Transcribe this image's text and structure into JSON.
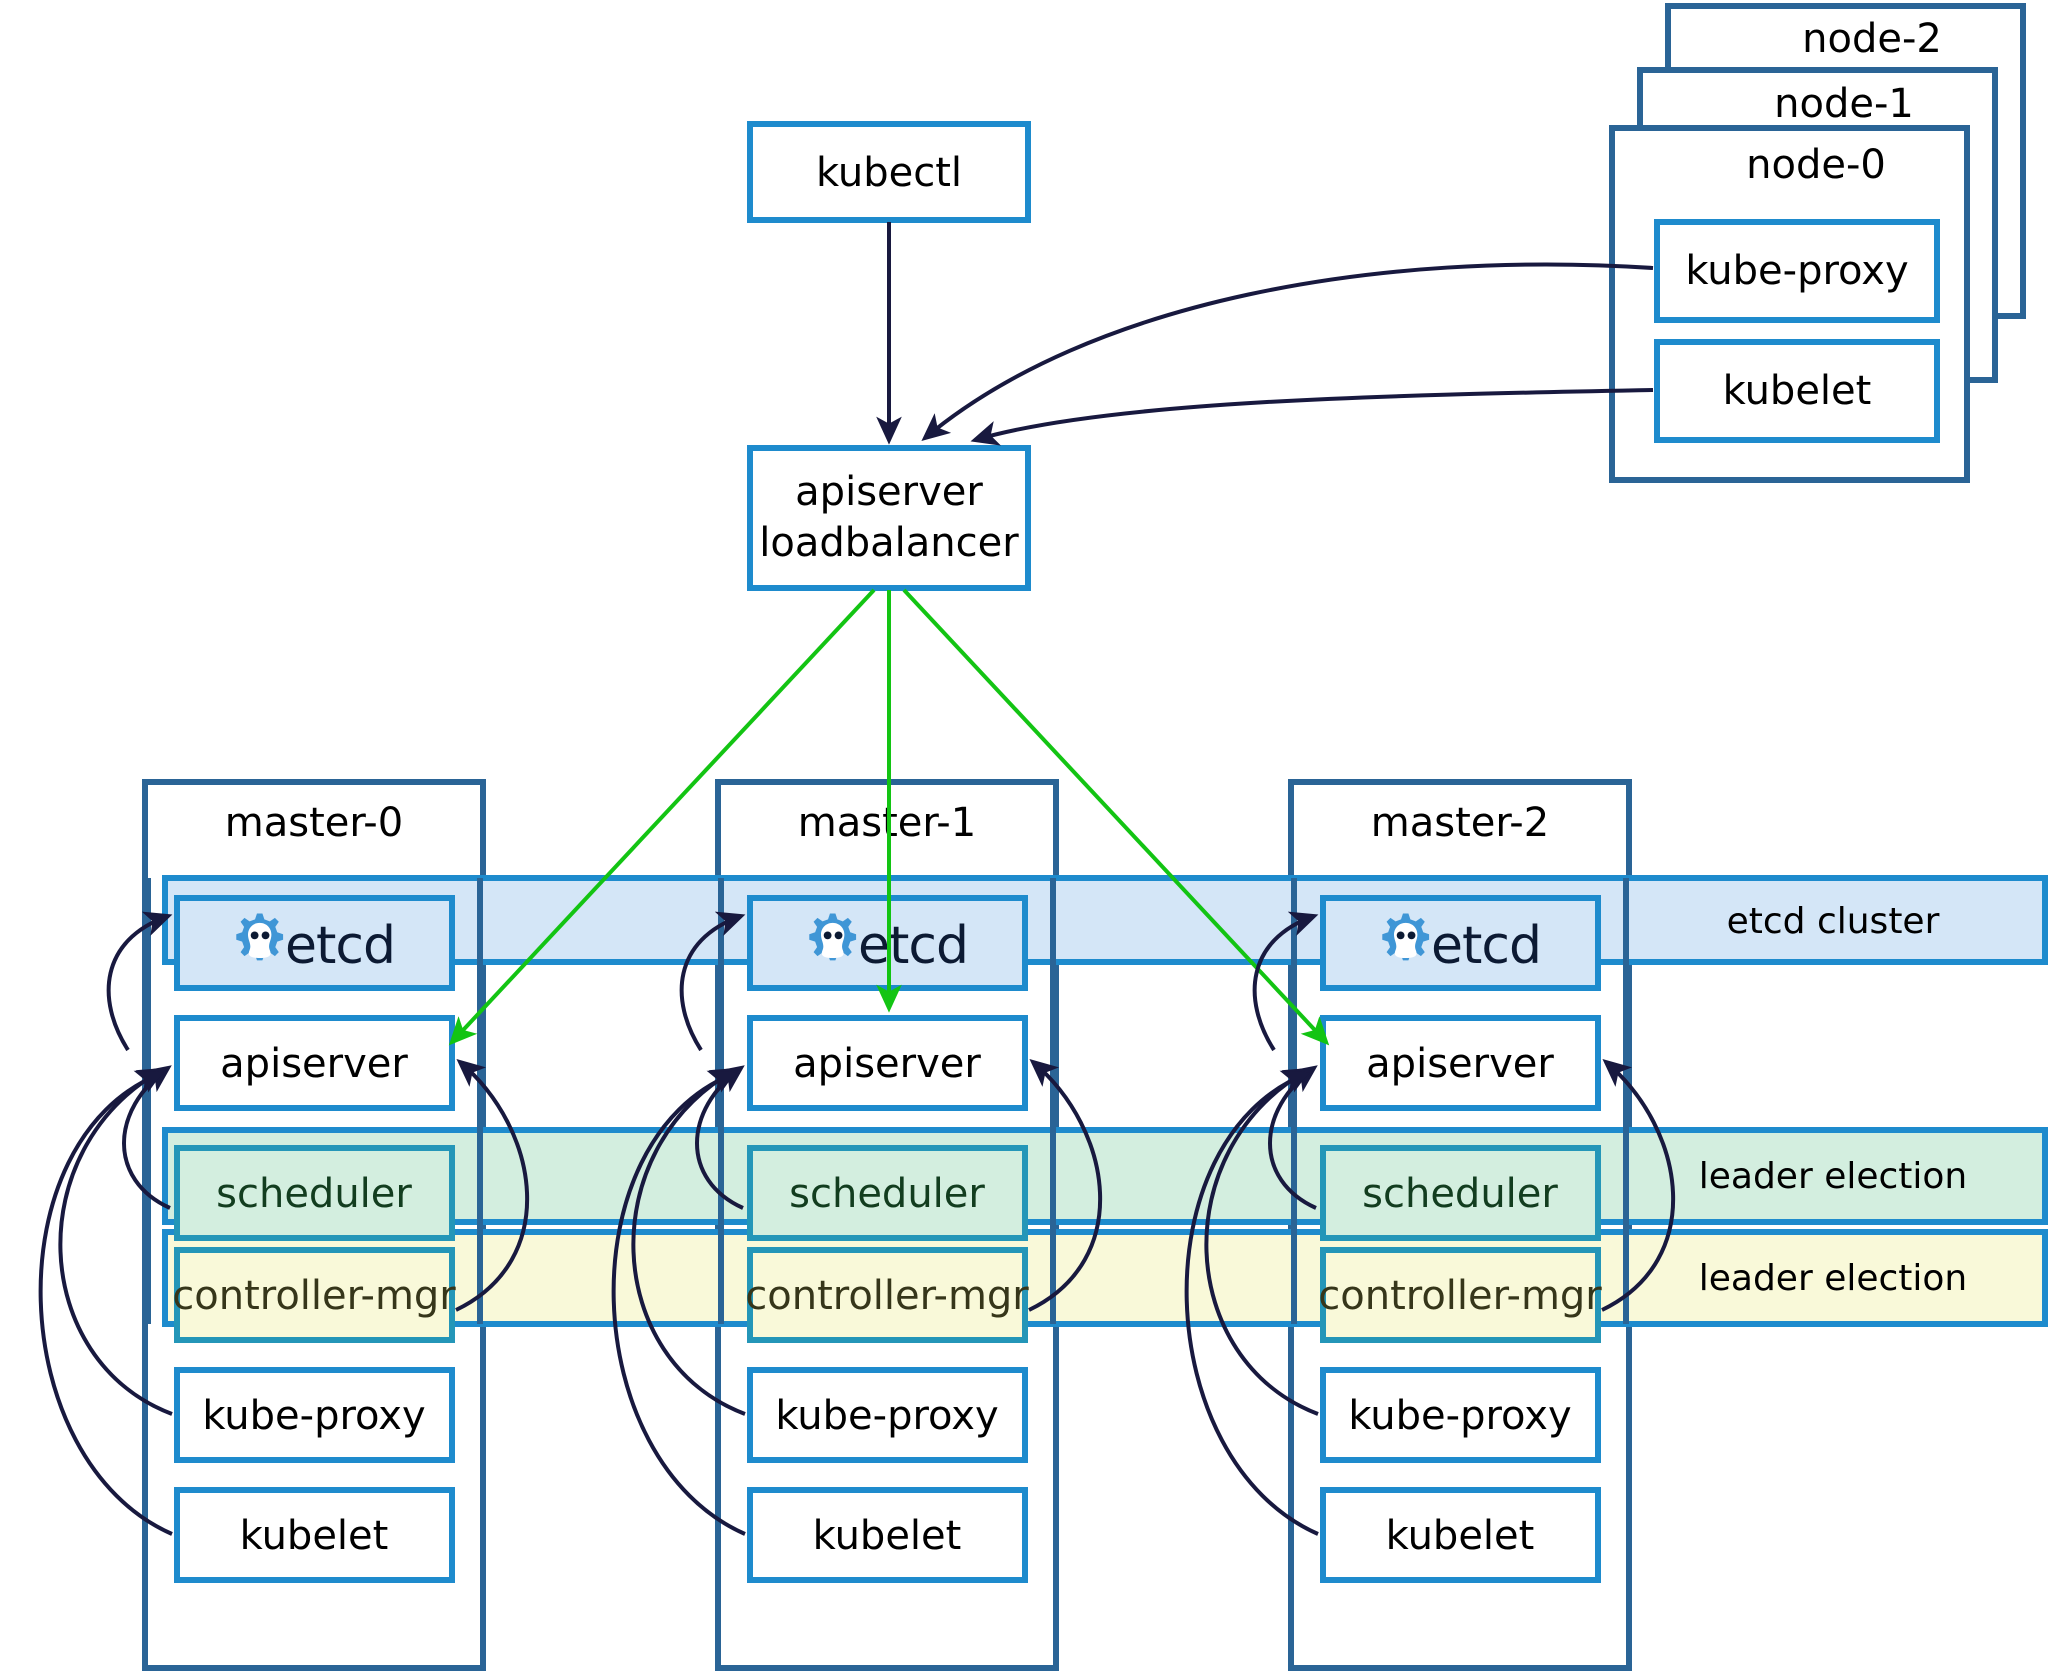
{
  "diagram": {
    "title": "Kubernetes high-availability cluster architecture",
    "colors": {
      "node_border": "#2a6496",
      "box_border": "#1e8bcd",
      "etcd_band": "#d4e6f7",
      "scheduler_band": "#d3eedf",
      "controller_band": "#f9f9d9",
      "arrow_dark": "#18193f",
      "arrow_green": "#13c413",
      "etcd_logo": "#3f96d6"
    }
  },
  "client": {
    "kubectl_label": "kubectl"
  },
  "loadbalancer": {
    "line1": "apiserver",
    "line2": "loadbalancer"
  },
  "nodes": {
    "stack_labels": [
      "node-2",
      "node-1",
      "node-0"
    ],
    "front_label": "node-0",
    "components": [
      {
        "label": "kube-proxy"
      },
      {
        "label": "kubelet"
      }
    ]
  },
  "masters": [
    {
      "title": "master-0",
      "etcd_label": "etcd",
      "apiserver_label": "apiserver",
      "scheduler_label": "scheduler",
      "controller_label": "controller-mgr",
      "kube_proxy_label": "kube-proxy",
      "kubelet_label": "kubelet"
    },
    {
      "title": "master-1",
      "etcd_label": "etcd",
      "apiserver_label": "apiserver",
      "scheduler_label": "scheduler",
      "controller_label": "controller-mgr",
      "kube_proxy_label": "kube-proxy",
      "kubelet_label": "kubelet"
    },
    {
      "title": "master-2",
      "etcd_label": "etcd",
      "apiserver_label": "apiserver",
      "scheduler_label": "scheduler",
      "controller_label": "controller-mgr",
      "kube_proxy_label": "kube-proxy",
      "kubelet_label": "kubelet"
    }
  ],
  "bands": {
    "etcd_cluster_label": "etcd cluster",
    "scheduler_election_label": "leader election",
    "controller_election_label": "leader election"
  }
}
